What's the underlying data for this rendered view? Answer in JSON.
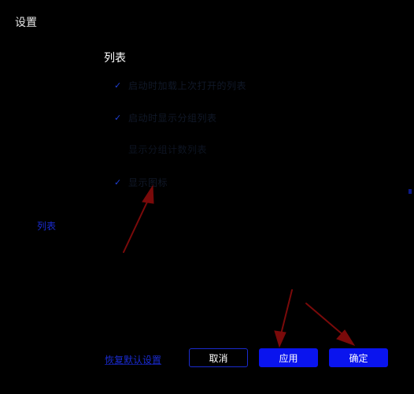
{
  "window": {
    "title": "设置"
  },
  "section": {
    "title": "列表"
  },
  "options": [
    {
      "label": "启动时加载上次打开的列表",
      "checked": true
    },
    {
      "label": "启动时显示分组列表",
      "checked": true
    },
    {
      "label": "显示分组计数列表",
      "checked": false
    },
    {
      "label": "显示图标",
      "checked": true
    }
  ],
  "sidebar": {
    "items": [
      {
        "label": "列表"
      }
    ]
  },
  "footer": {
    "reset_label": "恢复默认设置",
    "cancel_label": "取消",
    "apply_label": "应用",
    "ok_label": "确定"
  },
  "colors": {
    "background": "#000000",
    "accent": "#0a14ee",
    "annotation_arrow": "#7a0a0a"
  },
  "icons": {
    "check": "checkmark-icon"
  }
}
